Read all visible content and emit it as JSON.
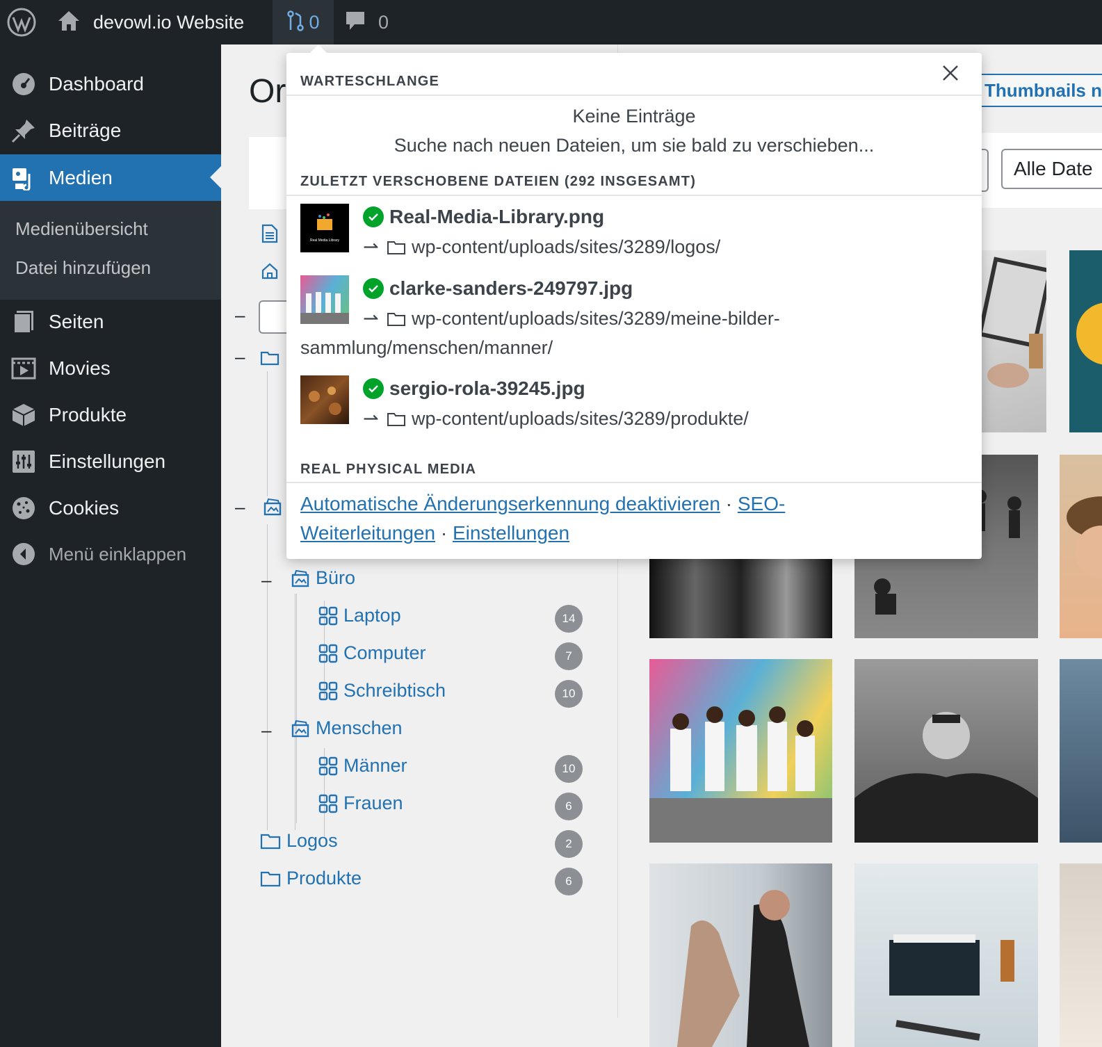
{
  "adminbar": {
    "site_name": "devowl.io Website",
    "queue_count": "0",
    "comments_count": "0"
  },
  "sidebar": {
    "items": [
      {
        "label": "Dashboard",
        "icon": "dashboard-icon"
      },
      {
        "label": "Beiträge",
        "icon": "pin-icon"
      },
      {
        "label": "Medien",
        "icon": "media-icon",
        "current": true
      },
      {
        "label": "Seiten",
        "icon": "pages-icon"
      },
      {
        "label": "Movies",
        "icon": "video-icon"
      },
      {
        "label": "Produkte",
        "icon": "box-icon"
      },
      {
        "label": "Einstellungen",
        "icon": "settings-icon"
      },
      {
        "label": "Cookies",
        "icon": "cookie-icon"
      }
    ],
    "submenu": [
      "Medienübersicht",
      "Datei hinzufügen"
    ],
    "collapse_label": "Menü einklappen"
  },
  "main": {
    "title_partial": "Or",
    "view_button": "Thumbnails n",
    "date_filter": "Alle Date"
  },
  "tree": {
    "buero": {
      "label": "Büro"
    },
    "laptop": {
      "label": "Laptop",
      "count": "14"
    },
    "computer": {
      "label": "Computer",
      "count": "7"
    },
    "schreibtisch": {
      "label": "Schreibtisch",
      "count": "10"
    },
    "menschen": {
      "label": "Menschen"
    },
    "maenner": {
      "label": "Männer",
      "count": "10"
    },
    "frauen": {
      "label": "Frauen",
      "count": "6"
    },
    "logos": {
      "label": "Logos",
      "count": "2"
    },
    "produkte": {
      "label": "Produkte",
      "count": "6"
    }
  },
  "popup": {
    "queue_heading": "WARTESCHLANGE",
    "no_entries": "Keine Einträge",
    "searching": "Suche nach neuen Dateien, um sie bald zu verschieben...",
    "recent_heading": "ZULETZT VERSCHOBENE DATEIEN (292 INSGESAMT)",
    "files": [
      {
        "name": "Real-Media-Library.png",
        "path": "wp-content/uploads/sites/3289/logos/",
        "thumb_caption": "Real Media Library"
      },
      {
        "name": "clarke-sanders-249797.jpg",
        "path": "wp-content/uploads/sites/3289/meine-bilder-sammlung/menschen/manner/"
      },
      {
        "name": "sergio-rola-39245.jpg",
        "path": "wp-content/uploads/sites/3289/produkte/"
      }
    ],
    "rpm_heading": "REAL PHYSICAL MEDIA",
    "links": {
      "auto_detect": "Automatische Änderungserkennung deaktivieren",
      "separator": "·",
      "seo": "SEO-Weiterleitungen",
      "settings": "Einstellungen"
    }
  },
  "colors": {
    "admin_dark": "#1d2327",
    "accent": "#2271b1",
    "success": "#00a32a",
    "badge": "#8c8f94"
  }
}
